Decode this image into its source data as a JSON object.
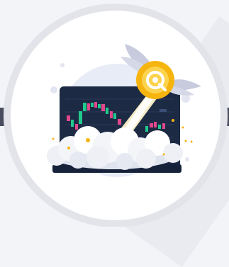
{
  "illustration": {
    "colors": {
      "background": "#f3f4f7",
      "outer_ring": "#e2e4ea",
      "inner_disc": "#ffffff",
      "halo": "#e8ecf7",
      "monitor": "#1d2a44",
      "monitor_dark": "#16213a",
      "candle_green": "#22c98c",
      "candle_pink": "#e0488b",
      "coin_outer": "#f6b40f",
      "coin_inner": "#fcd34d",
      "wing": "#c7cbdd",
      "cloud": "#eef0f6",
      "sparkle": "#f6b40f"
    },
    "icons": [
      "rocket-coin-icon",
      "wing-icon",
      "cloud-icon",
      "candlestick-chart-icon"
    ]
  }
}
